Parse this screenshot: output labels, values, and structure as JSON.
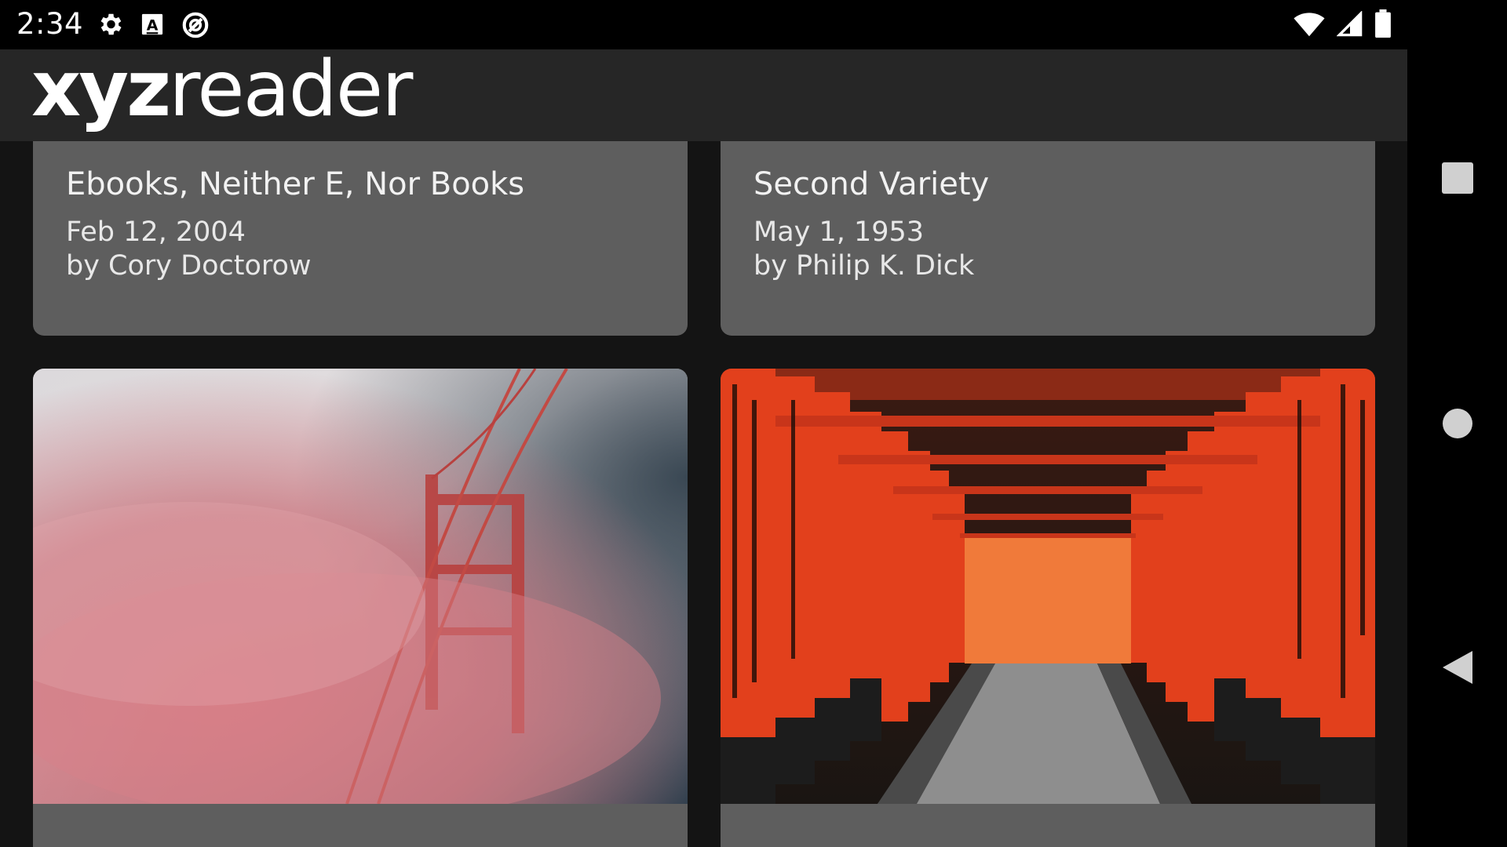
{
  "status_bar": {
    "time": "2:34",
    "icons_left": [
      "settings-icon",
      "a-font-icon",
      "data-saver-icon"
    ],
    "icons_right": [
      "wifi-icon",
      "cell-signal-icon",
      "battery-icon"
    ]
  },
  "toolbar": {
    "logo_bold": "xyz",
    "logo_light": "reader"
  },
  "articles": [
    {
      "title": "Ebooks, Neither E, Nor Books",
      "date": "Feb 12, 2004",
      "author": "by Cory Doctorow"
    },
    {
      "title": "Second Variety",
      "date": "May 1, 1953",
      "author": "by Philip K. Dick"
    },
    {
      "image": "golden-gate-fog-photo"
    },
    {
      "image": "torii-gates-photo"
    }
  ],
  "nav_bar": {
    "buttons": [
      "recents-square-icon",
      "home-circle-icon",
      "back-triangle-icon"
    ]
  },
  "colors": {
    "status_bar": "#000000",
    "toolbar": "#262626",
    "card": "#5e5e5e",
    "background": "#141414"
  }
}
